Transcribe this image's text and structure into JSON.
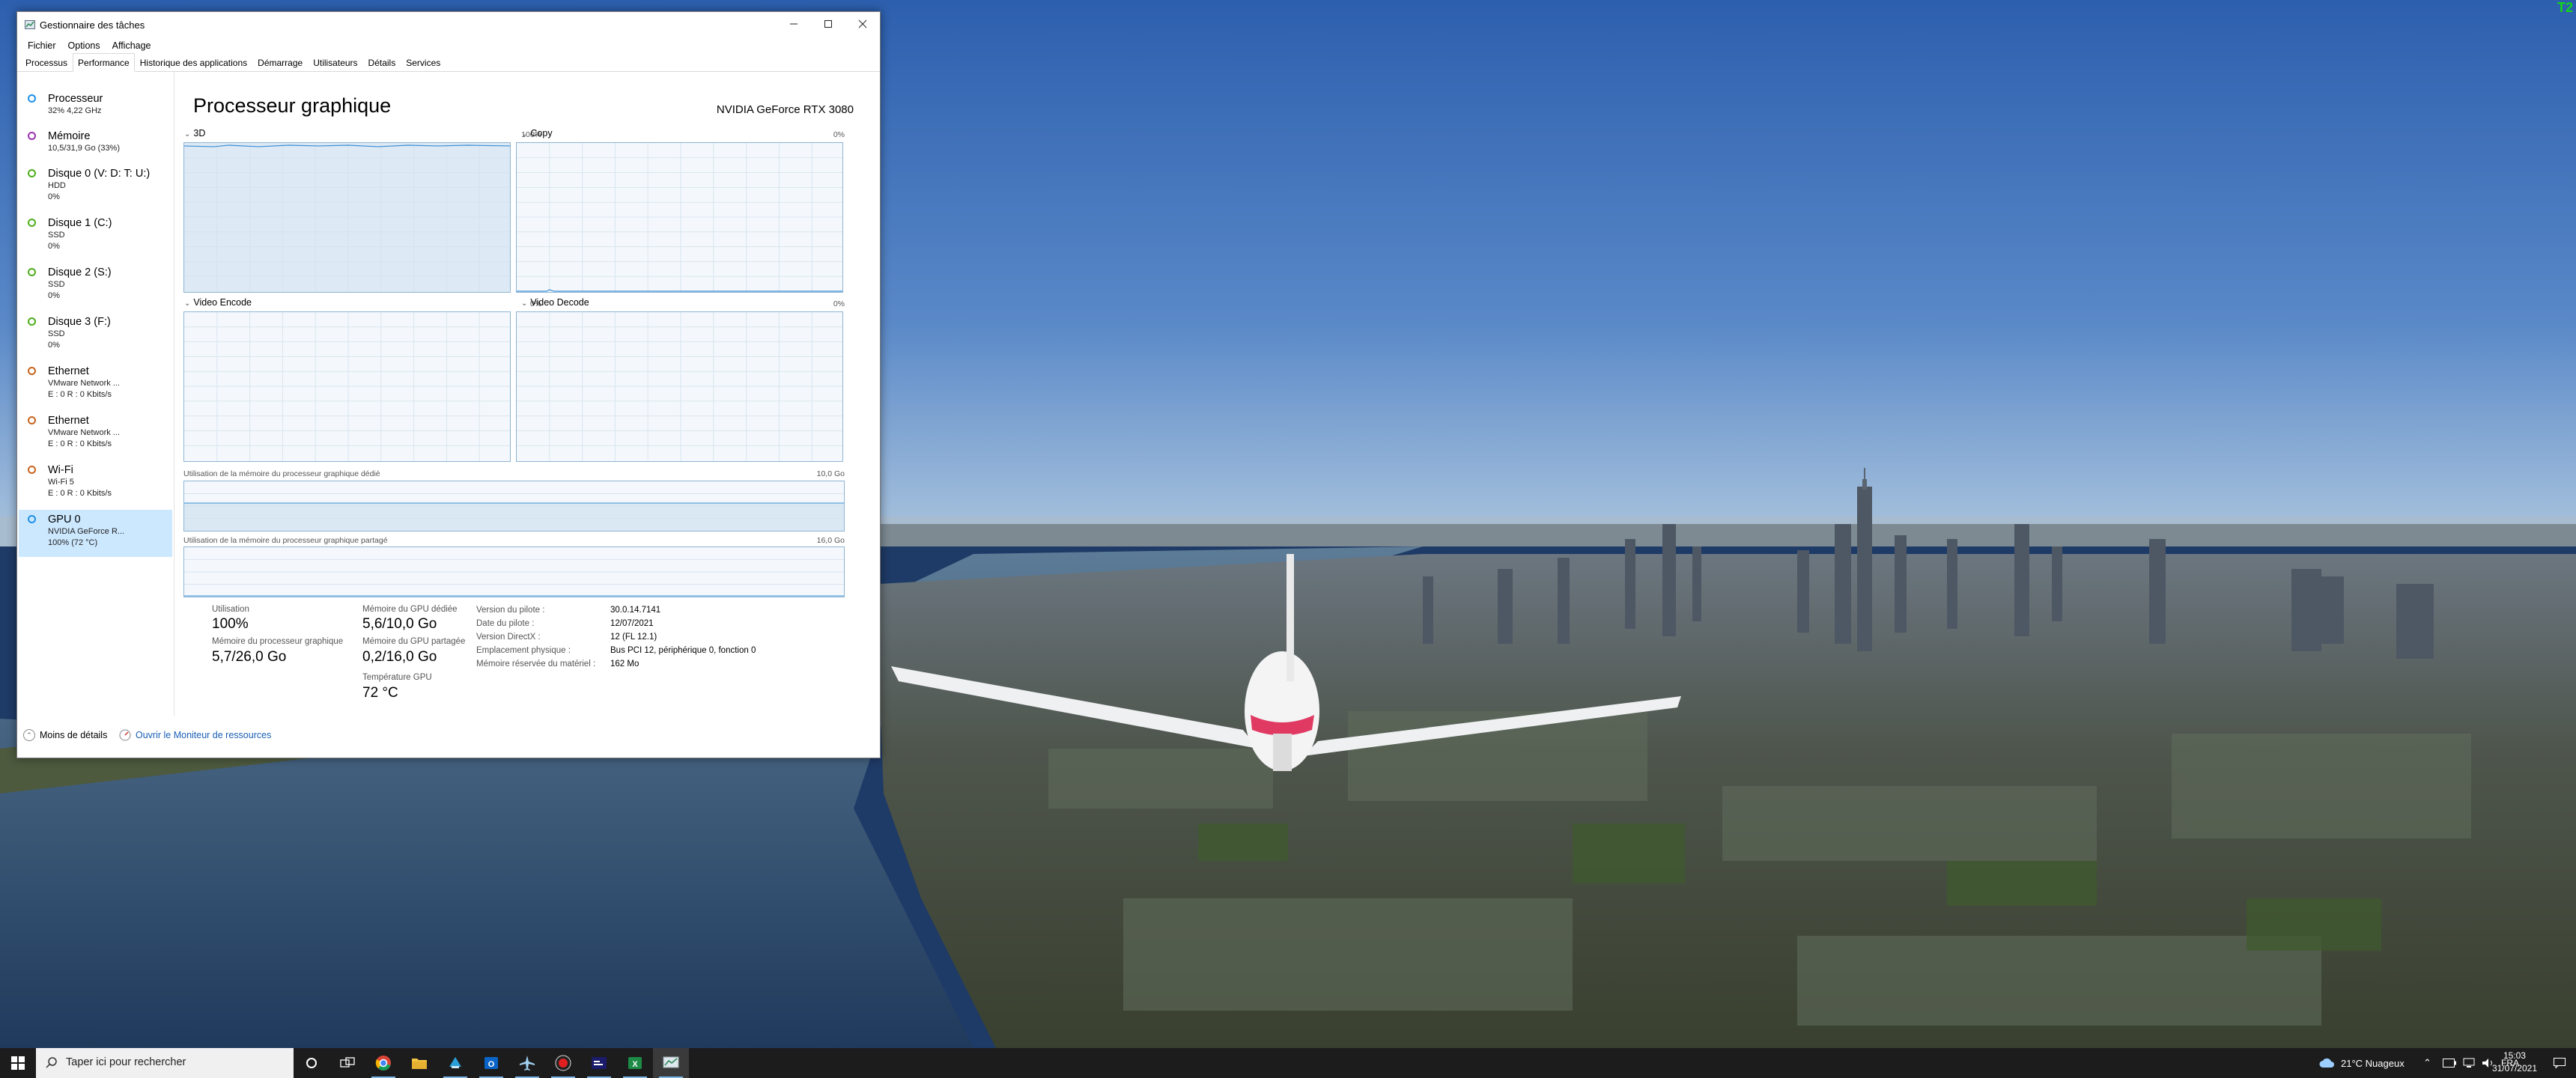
{
  "desktop": {
    "corner_text": "T2"
  },
  "window": {
    "title": "Gestionnaire des tâches",
    "menu": [
      "Fichier",
      "Options",
      "Affichage"
    ],
    "tabs": [
      "Processus",
      "Performance",
      "Historique des applications",
      "Démarrage",
      "Utilisateurs",
      "Détails",
      "Services"
    ],
    "active_tab": "Performance"
  },
  "sidebar": {
    "items": [
      {
        "name": "Processeur",
        "line1": "32% 4,22 GHz",
        "line2": "",
        "color": "#1e90e6"
      },
      {
        "name": "Mémoire",
        "line1": "10,5/31,9 Go (33%)",
        "line2": "",
        "color": "#9b2fae"
      },
      {
        "name": "Disque 0 (V: D: T: U:)",
        "line1": "HDD",
        "line2": "0%",
        "color": "#4cae1b"
      },
      {
        "name": "Disque 1 (C:)",
        "line1": "SSD",
        "line2": "0%",
        "color": "#4cae1b"
      },
      {
        "name": "Disque 2 (S:)",
        "line1": "SSD",
        "line2": "0%",
        "color": "#4cae1b"
      },
      {
        "name": "Disque 3 (F:)",
        "line1": "SSD",
        "line2": "0%",
        "color": "#4cae1b"
      },
      {
        "name": "Ethernet",
        "line1": "VMware Network ...",
        "line2": "E : 0 R : 0 Kbits/s",
        "color": "#c8641e"
      },
      {
        "name": "Ethernet",
        "line1": "VMware Network ...",
        "line2": "E : 0 R : 0 Kbits/s",
        "color": "#c8641e"
      },
      {
        "name": "Wi-Fi",
        "line1": "Wi-Fi 5",
        "line2": "E : 0 R : 0 Kbits/s",
        "color": "#c8641e"
      },
      {
        "name": "GPU 0",
        "line1": "NVIDIA GeForce R...",
        "line2": "100% (72 °C)",
        "color": "#1e90e6"
      }
    ],
    "selected_index": 9
  },
  "main": {
    "title": "Processeur graphique",
    "gpu_name": "NVIDIA GeForce RTX 3080",
    "engines": [
      {
        "label": "3D",
        "pct": "100%",
        "level": 1.0
      },
      {
        "label": "Copy",
        "pct": "0%",
        "level": 0.0
      },
      {
        "label": "Video Encode",
        "pct": "0%",
        "level": 0.0
      },
      {
        "label": "Video Decode",
        "pct": "0%",
        "level": 0.0
      }
    ],
    "dedicated_mem": {
      "label": "Utilisation de la mémoire du processeur graphique dédié",
      "max": "10,0 Go",
      "level": 0.56
    },
    "shared_mem": {
      "label": "Utilisation de la mémoire du processeur graphique partagé",
      "max": "16,0 Go",
      "level": 0.01
    },
    "stats": {
      "util_label": "Utilisation",
      "util_value": "100%",
      "gpu_mem_label": "Mémoire du processeur graphique",
      "gpu_mem_value": "5,7/26,0 Go",
      "dedicated_label": "Mémoire du GPU dédiée",
      "dedicated_value": "5,6/10,0 Go",
      "shared_label": "Mémoire du GPU partagée",
      "shared_value": "0,2/16,0 Go",
      "temp_label": "Température GPU",
      "temp_value": "72 °C"
    },
    "info": [
      {
        "k": "Version du pilote :",
        "v": "30.0.14.7141"
      },
      {
        "k": "Date du pilote :",
        "v": "12/07/2021"
      },
      {
        "k": "Version DirectX :",
        "v": "12 (FL 12.1)"
      },
      {
        "k": "Emplacement physique :",
        "v": "Bus PCI 12, périphérique 0, fonction 0"
      },
      {
        "k": "Mémoire réservée du matériel :",
        "v": "162 Mo"
      }
    ]
  },
  "footer": {
    "fewer_details": "Moins de détails",
    "open_monitor": "Ouvrir le Moniteur de ressources"
  },
  "taskbar": {
    "search_placeholder": "Taper ici pour rechercher",
    "weather": "21°C  Nuageux",
    "lang": "FRA",
    "time": "15:03",
    "date": "31/07/2021"
  }
}
